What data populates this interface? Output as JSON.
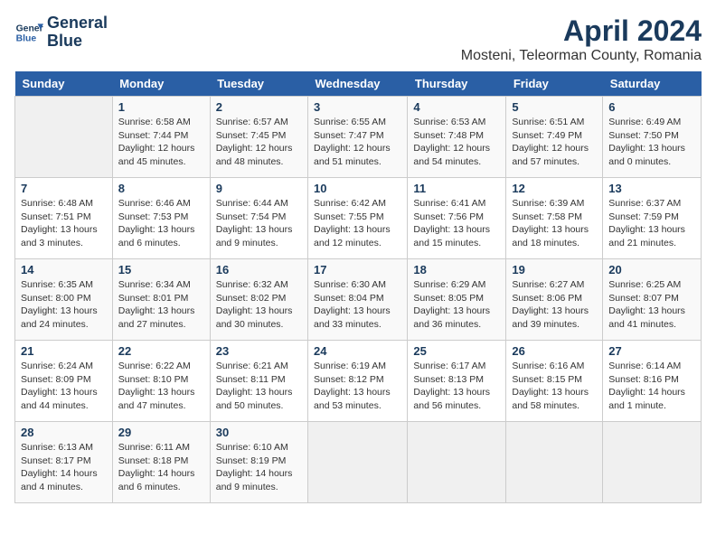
{
  "header": {
    "logo_line1": "General",
    "logo_line2": "Blue",
    "month_title": "April 2024",
    "location": "Mosteni, Teleorman County, Romania"
  },
  "weekdays": [
    "Sunday",
    "Monday",
    "Tuesday",
    "Wednesday",
    "Thursday",
    "Friday",
    "Saturday"
  ],
  "weeks": [
    [
      {
        "day": "",
        "content": ""
      },
      {
        "day": "1",
        "content": "Sunrise: 6:58 AM\nSunset: 7:44 PM\nDaylight: 12 hours\nand 45 minutes."
      },
      {
        "day": "2",
        "content": "Sunrise: 6:57 AM\nSunset: 7:45 PM\nDaylight: 12 hours\nand 48 minutes."
      },
      {
        "day": "3",
        "content": "Sunrise: 6:55 AM\nSunset: 7:47 PM\nDaylight: 12 hours\nand 51 minutes."
      },
      {
        "day": "4",
        "content": "Sunrise: 6:53 AM\nSunset: 7:48 PM\nDaylight: 12 hours\nand 54 minutes."
      },
      {
        "day": "5",
        "content": "Sunrise: 6:51 AM\nSunset: 7:49 PM\nDaylight: 12 hours\nand 57 minutes."
      },
      {
        "day": "6",
        "content": "Sunrise: 6:49 AM\nSunset: 7:50 PM\nDaylight: 13 hours\nand 0 minutes."
      }
    ],
    [
      {
        "day": "7",
        "content": "Sunrise: 6:48 AM\nSunset: 7:51 PM\nDaylight: 13 hours\nand 3 minutes."
      },
      {
        "day": "8",
        "content": "Sunrise: 6:46 AM\nSunset: 7:53 PM\nDaylight: 13 hours\nand 6 minutes."
      },
      {
        "day": "9",
        "content": "Sunrise: 6:44 AM\nSunset: 7:54 PM\nDaylight: 13 hours\nand 9 minutes."
      },
      {
        "day": "10",
        "content": "Sunrise: 6:42 AM\nSunset: 7:55 PM\nDaylight: 13 hours\nand 12 minutes."
      },
      {
        "day": "11",
        "content": "Sunrise: 6:41 AM\nSunset: 7:56 PM\nDaylight: 13 hours\nand 15 minutes."
      },
      {
        "day": "12",
        "content": "Sunrise: 6:39 AM\nSunset: 7:58 PM\nDaylight: 13 hours\nand 18 minutes."
      },
      {
        "day": "13",
        "content": "Sunrise: 6:37 AM\nSunset: 7:59 PM\nDaylight: 13 hours\nand 21 minutes."
      }
    ],
    [
      {
        "day": "14",
        "content": "Sunrise: 6:35 AM\nSunset: 8:00 PM\nDaylight: 13 hours\nand 24 minutes."
      },
      {
        "day": "15",
        "content": "Sunrise: 6:34 AM\nSunset: 8:01 PM\nDaylight: 13 hours\nand 27 minutes."
      },
      {
        "day": "16",
        "content": "Sunrise: 6:32 AM\nSunset: 8:02 PM\nDaylight: 13 hours\nand 30 minutes."
      },
      {
        "day": "17",
        "content": "Sunrise: 6:30 AM\nSunset: 8:04 PM\nDaylight: 13 hours\nand 33 minutes."
      },
      {
        "day": "18",
        "content": "Sunrise: 6:29 AM\nSunset: 8:05 PM\nDaylight: 13 hours\nand 36 minutes."
      },
      {
        "day": "19",
        "content": "Sunrise: 6:27 AM\nSunset: 8:06 PM\nDaylight: 13 hours\nand 39 minutes."
      },
      {
        "day": "20",
        "content": "Sunrise: 6:25 AM\nSunset: 8:07 PM\nDaylight: 13 hours\nand 41 minutes."
      }
    ],
    [
      {
        "day": "21",
        "content": "Sunrise: 6:24 AM\nSunset: 8:09 PM\nDaylight: 13 hours\nand 44 minutes."
      },
      {
        "day": "22",
        "content": "Sunrise: 6:22 AM\nSunset: 8:10 PM\nDaylight: 13 hours\nand 47 minutes."
      },
      {
        "day": "23",
        "content": "Sunrise: 6:21 AM\nSunset: 8:11 PM\nDaylight: 13 hours\nand 50 minutes."
      },
      {
        "day": "24",
        "content": "Sunrise: 6:19 AM\nSunset: 8:12 PM\nDaylight: 13 hours\nand 53 minutes."
      },
      {
        "day": "25",
        "content": "Sunrise: 6:17 AM\nSunset: 8:13 PM\nDaylight: 13 hours\nand 56 minutes."
      },
      {
        "day": "26",
        "content": "Sunrise: 6:16 AM\nSunset: 8:15 PM\nDaylight: 13 hours\nand 58 minutes."
      },
      {
        "day": "27",
        "content": "Sunrise: 6:14 AM\nSunset: 8:16 PM\nDaylight: 14 hours\nand 1 minute."
      }
    ],
    [
      {
        "day": "28",
        "content": "Sunrise: 6:13 AM\nSunset: 8:17 PM\nDaylight: 14 hours\nand 4 minutes."
      },
      {
        "day": "29",
        "content": "Sunrise: 6:11 AM\nSunset: 8:18 PM\nDaylight: 14 hours\nand 6 minutes."
      },
      {
        "day": "30",
        "content": "Sunrise: 6:10 AM\nSunset: 8:19 PM\nDaylight: 14 hours\nand 9 minutes."
      },
      {
        "day": "",
        "content": ""
      },
      {
        "day": "",
        "content": ""
      },
      {
        "day": "",
        "content": ""
      },
      {
        "day": "",
        "content": ""
      }
    ]
  ]
}
